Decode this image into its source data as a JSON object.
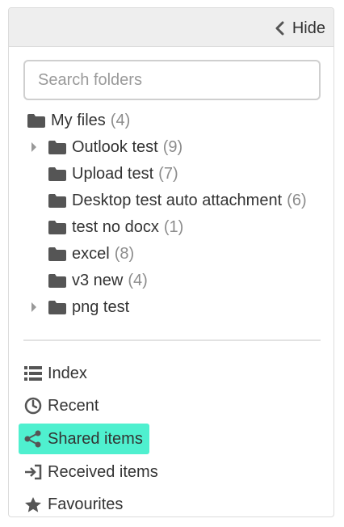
{
  "header": {
    "hide_label": "Hide"
  },
  "search": {
    "placeholder": "Search folders"
  },
  "tree": {
    "root": {
      "label": "My files",
      "count": "(4)"
    },
    "folders": [
      {
        "label": "Outlook test",
        "count": "(9)",
        "expandable": true
      },
      {
        "label": "Upload test",
        "count": "(7)",
        "expandable": false
      },
      {
        "label": "Desktop test auto attachment",
        "count": "(6)",
        "expandable": false
      },
      {
        "label": "test no docx",
        "count": "(1)",
        "expandable": false
      },
      {
        "label": "excel",
        "count": "(8)",
        "expandable": false
      },
      {
        "label": "v3 new",
        "count": "(4)",
        "expandable": false
      },
      {
        "label": "png test",
        "count": "",
        "expandable": true
      }
    ]
  },
  "nav": {
    "items": [
      {
        "label": "Index",
        "icon": "list-icon"
      },
      {
        "label": "Recent",
        "icon": "clock-icon"
      },
      {
        "label": "Shared items",
        "icon": "share-icon",
        "active": true
      },
      {
        "label": "Received items",
        "icon": "sign-in-icon"
      },
      {
        "label": "Favourites",
        "icon": "star-icon"
      }
    ]
  },
  "colors": {
    "active_highlight": "#4ff0cf",
    "count_text": "#8c8c8c",
    "header_bg": "#eeeeee"
  }
}
